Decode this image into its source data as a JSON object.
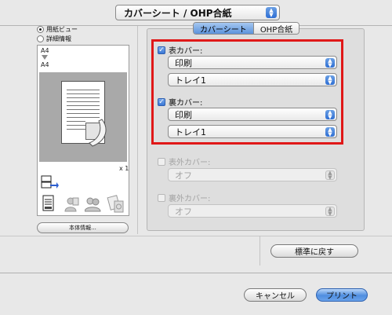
{
  "top_popup": {
    "label": "カバーシート / OHP合紙"
  },
  "left": {
    "view_options": [
      {
        "label": "用紙ビュー",
        "selected": true
      },
      {
        "label": "詳細情報",
        "selected": false
      }
    ],
    "size_from": "A4",
    "size_to": "A4",
    "copies": "x 1",
    "bottom_button": "本体情報..."
  },
  "tabs": [
    {
      "label": "カバーシート",
      "selected": true
    },
    {
      "label": "OHP合紙",
      "selected": false
    }
  ],
  "front_cover": {
    "label": "表カバー:",
    "checked": true,
    "print_value": "印刷",
    "tray_value": "トレイ1"
  },
  "back_cover": {
    "label": "裏カバー:",
    "checked": true,
    "print_value": "印刷",
    "tray_value": "トレイ1"
  },
  "front_outer_cover": {
    "label": "表外カバー:",
    "checked": false,
    "value": "オフ"
  },
  "back_outer_cover": {
    "label": "裏外カバー:",
    "checked": false,
    "value": "オフ"
  },
  "buttons": {
    "reset": "標準に戻す",
    "cancel": "キャンセル",
    "print": "プリント"
  },
  "colors": {
    "highlight": "#e01818",
    "accent": "#3a78d6"
  }
}
